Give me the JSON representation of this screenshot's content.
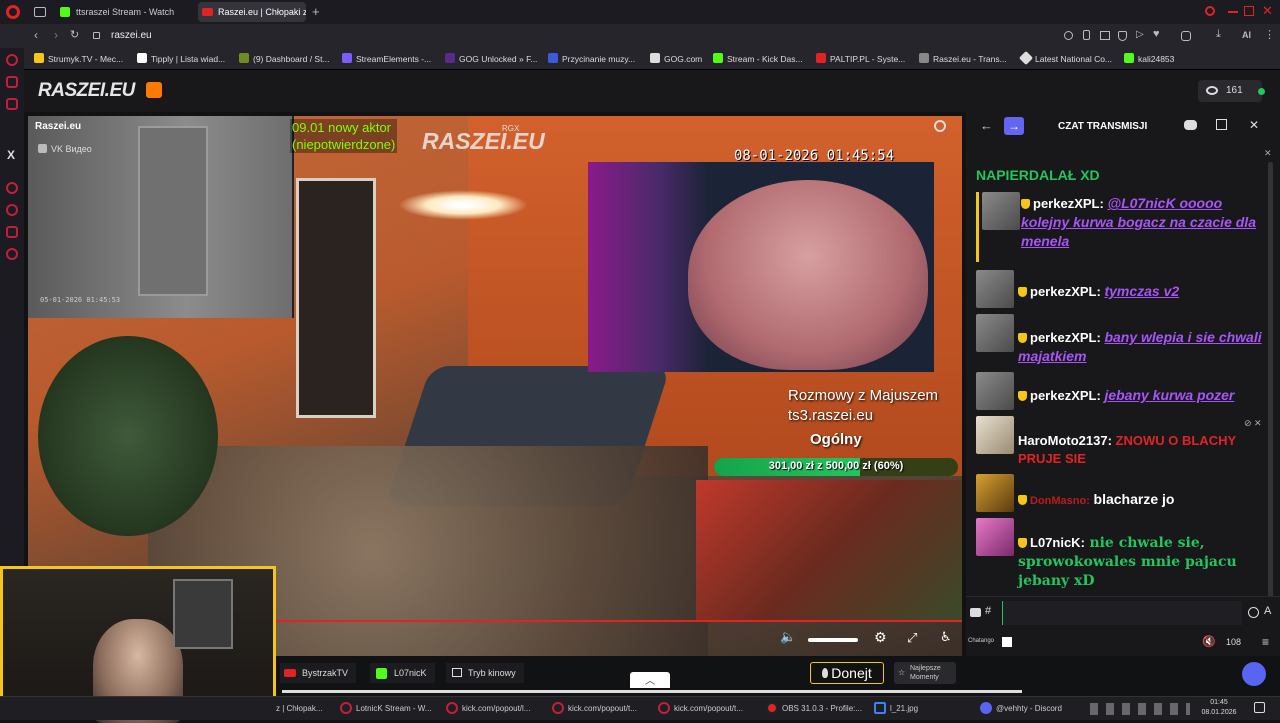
{
  "browser": {
    "tabs": [
      {
        "title": "ttsraszei Stream - Watch l",
        "icon": "kick-icon"
      },
      {
        "title": "Raszei.eu | Chłopaki z",
        "icon": "youtube-icon",
        "active": true
      }
    ],
    "url": "raszei.eu",
    "bookmarks": [
      "Strumyk.TV - Mec...",
      "Tipply | Lista wiad...",
      "(9) Dashboard / St...",
      "StreamElements -...",
      "GOG Unlocked » F...",
      "Przycinanie muzy...",
      "GOG.com",
      "Stream - Kick Das...",
      "PALTIP.PL - Syste...",
      "Raszei.eu - Trans...",
      "Latest National Co...",
      "kali24853"
    ],
    "ext_label": "AI"
  },
  "site": {
    "logo": "RASZEI.EU",
    "viewers": "161"
  },
  "player": {
    "channel": "Raszei.eu",
    "vk_label": "VK Видео",
    "overlay_news": "09.01 nowy aktor",
    "overlay_news2": "(niepotwierdzone)",
    "overlay_logo": "RASZEI.EU",
    "overlay_rgx": "RGX",
    "datetime": "08-01-2026 01:45:54",
    "ts_line1": "Rozmowy z Majuszem",
    "ts_line2": "ts3.raszei.eu",
    "ts_line3": "Ogólny",
    "goal_text": "301,00 zł z 500,00 zł (60%)",
    "goal_progress": 0.6,
    "cam_timestamp": "05-01-2026 01:45:53"
  },
  "chat": {
    "title": "CZAT TRANSMISJI",
    "top_text": "NAPIERDALAŁ XD",
    "messages": [
      {
        "user": "perkezXPL:",
        "text": "@L07nicK ooooo kolejny kurwa bogacz na czacie dla menela",
        "color": "#a855f7"
      },
      {
        "user": "perkezXPL:",
        "text": "tymczas v2",
        "color": "#a855f7"
      },
      {
        "user": "perkezXPL:",
        "text": "bany wlepia i sie chwali majatkiem",
        "color": "#a855f7"
      },
      {
        "user": "perkezXPL:",
        "text": "jebany kurwa pozer",
        "color": "#a855f7"
      },
      {
        "user": "HaroMoto2137:",
        "text": "ZNOWU O BLACHY PRUJE SIE",
        "color": "#e02424"
      },
      {
        "user": "DonMasno:",
        "text": "blacharze jo",
        "color": "#ffffff"
      },
      {
        "user": "L07nicK:",
        "text": "nie chwale sie, sprowokowales mnie pajacu jebany xD",
        "color": "#22c55e"
      }
    ],
    "input_hash": "#",
    "viewer_count": "108",
    "chatango_label": "Chatango"
  },
  "bottom": {
    "btn_bystrzak": "BystrzakTV",
    "btn_l07": "L07nicK",
    "btn_kino": "Tryb kinowy",
    "donejt": "Donejt",
    "najlepsze": "Najlepsze Momenty"
  },
  "taskbar": {
    "items": [
      "z | Chłopak...",
      "LotnicK Stream - W...",
      "kick.com/popout/l...",
      "kick.com/popout/t...",
      "kick.com/popout/t...",
      "OBS 31.0.3 - Profile:...",
      "l_21.jpg",
      "@vehhty - Discord"
    ],
    "time": "01:45",
    "date": "08.01.2026"
  },
  "colors": {
    "accent": "#e02424",
    "kick": "#53fc18",
    "chat_purple": "#a855f7",
    "goal_green": "#22c55e"
  }
}
